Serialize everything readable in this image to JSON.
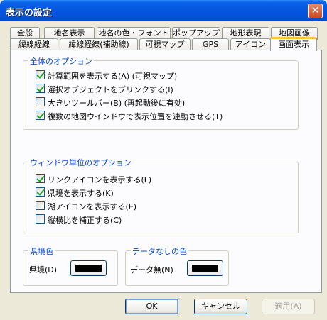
{
  "window": {
    "title": "表示の設定",
    "close_glyph": "✕"
  },
  "tabs_row1": [
    {
      "label": "全般"
    },
    {
      "label": "地名表示"
    },
    {
      "label": "地名の色・フォント"
    },
    {
      "label": "ポップアップ"
    },
    {
      "label": "地形表現"
    },
    {
      "label": "地図画像"
    }
  ],
  "tabs_row2": [
    {
      "label": "緯線経線"
    },
    {
      "label": "緯線経線(補助線)"
    },
    {
      "label": "可視マップ"
    },
    {
      "label": "GPS"
    },
    {
      "label": "アイコン"
    },
    {
      "label": "画面表示"
    }
  ],
  "group_overall": {
    "title": "全体のオプション",
    "options": [
      {
        "label": "計算範囲を表示する(A) (可視マップ)",
        "checked": true
      },
      {
        "label": "選択オブジェクトをブリンクする(I)",
        "checked": true
      },
      {
        "label": "大きいツールバー(B) (再起動後に有効)",
        "checked": false
      },
      {
        "label": "複数の地図ウインドウで表示位置を連動させる(T)",
        "checked": true
      }
    ]
  },
  "group_window": {
    "title": "ウィンドウ単位のオプション",
    "options": [
      {
        "label": "リンクアイコンを表示する(L)",
        "checked": true
      },
      {
        "label": "県境を表示する(K)",
        "checked": true
      },
      {
        "label": "湖アイコンを表示する(E)",
        "checked": false
      },
      {
        "label": "縦横比を補正する(C)",
        "checked": false
      }
    ]
  },
  "group_border_color": {
    "title": "県境色",
    "label": "県境(D)",
    "color": "#000000"
  },
  "group_nodata_color": {
    "title": "データなしの色",
    "label": "データ無(N)",
    "color": "#000000"
  },
  "buttons": {
    "ok": "OK",
    "cancel": "キャンセル",
    "apply": "適用(A)"
  }
}
